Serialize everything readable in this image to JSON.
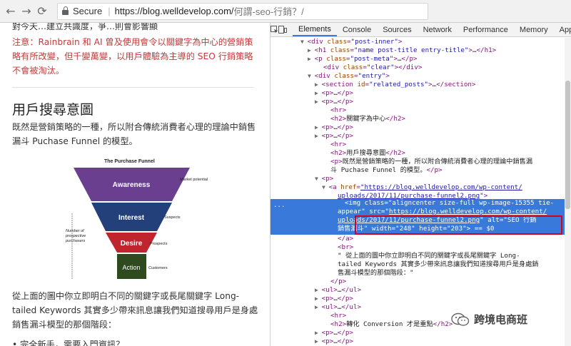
{
  "browser": {
    "back_glyph": "←",
    "forward_glyph": "→",
    "reload_glyph": "⟳",
    "secure_label": "Secure",
    "separator": "|",
    "url_host": "https://blog.welldevelop.com/",
    "url_path": "何謂-seo-行銷？/"
  },
  "article": {
    "top_clip": "對今天…建立共識度，爭…則會影響顯",
    "note": "注意：Rainbrain 和 AI 曾及使用會令以關鍵字為中心的營銷策略有所改變，但千變萬變，以用戶體驗為主導的 SEO 行銷策略不會被淘汰。",
    "heading": "用戶搜尋意圖",
    "para1": "既然是營銷策略的一種，所以附合傳統消費者心理的理論中銷售漏斗 Puchase Funnel 的模型。",
    "funnel": {
      "title": "The Purchase Funnel",
      "stages": [
        "Awareness",
        "Interest",
        "Desire",
        "Action"
      ],
      "right_labels": [
        "Market potential",
        "Suspects",
        "Prospects",
        "Customers"
      ],
      "left_label": "Number of prospective purchasers",
      "colors": [
        "#6b3f8f",
        "#23407a",
        "#c0242c",
        "#2f4a1f"
      ]
    },
    "para2": "從上面的圖中你立即明白不同的關鍵字或長尾關鍵字 Long-tailed Keywords 其實多少帶來訊息讓我們知道搜尋用戶是身處銷售漏斗模型的那個階段：",
    "bullet": "• 完全新手，需要入門資訊？"
  },
  "devtools": {
    "tabs": [
      "Elements",
      "Console",
      "Sources",
      "Network",
      "Performance",
      "Memory",
      "Applicat"
    ],
    "active_tab": "Elements",
    "accent": "#3879d9",
    "highlight_color": "#d3001c",
    "selected_dots": "...",
    "lines": [
      {
        "indent": 10,
        "tri": "▼",
        "parts": [
          [
            "tag",
            "<div "
          ],
          [
            "attr",
            "class"
          ],
          [
            "tag",
            "="
          ],
          [
            "val",
            "\"post-inner\""
          ],
          [
            "tag",
            ">"
          ]
        ]
      },
      {
        "indent": 12,
        "tri": "▶",
        "parts": [
          [
            "tag",
            "<h1 "
          ],
          [
            "attr",
            "class"
          ],
          [
            "tag",
            "="
          ],
          [
            "val",
            "\"name post-title entry-title\""
          ],
          [
            "tag",
            ">"
          ],
          [
            "txt",
            "…"
          ],
          [
            "tag",
            "</h1>"
          ]
        ]
      },
      {
        "indent": 12,
        "tri": "▶",
        "parts": [
          [
            "tag",
            "<p "
          ],
          [
            "attr",
            "class"
          ],
          [
            "tag",
            "="
          ],
          [
            "val",
            "\"post-meta\""
          ],
          [
            "tag",
            ">"
          ],
          [
            "txt",
            "…"
          ],
          [
            "tag",
            "</p>"
          ]
        ]
      },
      {
        "indent": 14,
        "tri": "",
        "parts": [
          [
            "tag",
            "<div "
          ],
          [
            "attr",
            "class"
          ],
          [
            "tag",
            "="
          ],
          [
            "val",
            "\"clear\""
          ],
          [
            "tag",
            "></div>"
          ]
        ]
      },
      {
        "indent": 12,
        "tri": "▼",
        "parts": [
          [
            "tag",
            "<div "
          ],
          [
            "attr",
            "class"
          ],
          [
            "tag",
            "="
          ],
          [
            "val",
            "\"entry\""
          ],
          [
            "tag",
            ">"
          ]
        ]
      },
      {
        "indent": 14,
        "tri": "▶",
        "parts": [
          [
            "tag",
            "<section "
          ],
          [
            "attr",
            "id"
          ],
          [
            "tag",
            "="
          ],
          [
            "val",
            "\"related_posts\""
          ],
          [
            "tag",
            ">"
          ],
          [
            "txt",
            "…"
          ],
          [
            "tag",
            "</section>"
          ]
        ]
      },
      {
        "indent": 14,
        "tri": "▶",
        "parts": [
          [
            "tag",
            "<p>"
          ],
          [
            "txt",
            "…"
          ],
          [
            "tag",
            "</p>"
          ]
        ]
      },
      {
        "indent": 14,
        "tri": "▶",
        "parts": [
          [
            "tag",
            "<p>"
          ],
          [
            "txt",
            "…"
          ],
          [
            "tag",
            "</p>"
          ]
        ]
      },
      {
        "indent": 16,
        "tri": "",
        "parts": [
          [
            "tag",
            "<hr>"
          ]
        ]
      },
      {
        "indent": 16,
        "tri": "",
        "parts": [
          [
            "tag",
            "<h2>"
          ],
          [
            "txt",
            "關鍵字為中心"
          ],
          [
            "tag",
            "</h2>"
          ]
        ]
      },
      {
        "indent": 14,
        "tri": "▶",
        "parts": [
          [
            "tag",
            "<p>"
          ],
          [
            "txt",
            "…"
          ],
          [
            "tag",
            "</p>"
          ]
        ]
      },
      {
        "indent": 14,
        "tri": "▶",
        "parts": [
          [
            "tag",
            "<p>"
          ],
          [
            "txt",
            "…"
          ],
          [
            "tag",
            "</p>"
          ]
        ]
      },
      {
        "indent": 16,
        "tri": "",
        "parts": [
          [
            "tag",
            "<hr>"
          ]
        ]
      },
      {
        "indent": 16,
        "tri": "",
        "parts": [
          [
            "tag",
            "<h2>"
          ],
          [
            "txt",
            "用戶搜尋意圖"
          ],
          [
            "tag",
            "</h2>"
          ]
        ]
      },
      {
        "indent": 16,
        "tri": "",
        "parts": [
          [
            "tag",
            "<p>"
          ],
          [
            "txt",
            "既然是營銷策略的一種，所以附合傳統消費者心理的理論中銷售漏"
          ]
        ]
      },
      {
        "indent": 16,
        "tri": "",
        "parts": [
          [
            "txt",
            "斗 Puchase Funnel 的模型。"
          ],
          [
            "tag",
            "</p>"
          ]
        ]
      },
      {
        "indent": 14,
        "tri": "▼",
        "parts": [
          [
            "tag",
            "<p>"
          ]
        ]
      },
      {
        "indent": 16,
        "tri": "▼",
        "parts": [
          [
            "tag",
            "<a "
          ],
          [
            "attr",
            "href"
          ],
          [
            "tag",
            "="
          ],
          [
            "link",
            "\"https://blog.welldevelop.com/wp-content/"
          ]
        ]
      },
      {
        "indent": 18,
        "tri": "",
        "parts": [
          [
            "link",
            "uploads/2017/11/purchase-funnel2.png"
          ],
          [
            "val",
            "\""
          ],
          [
            "tag",
            ">"
          ]
        ]
      },
      {
        "indent": 20,
        "tri": "",
        "parts": [
          [
            "tag",
            "<img "
          ],
          [
            "attr",
            "class"
          ],
          [
            "tag",
            "="
          ],
          [
            "val",
            "\"aligncenter size-full wp-image-15355 tie-"
          ]
        ]
      },
      {
        "indent": 18,
        "tri": "",
        "parts": [
          [
            "val",
            "appear\" "
          ],
          [
            "attr",
            "src"
          ],
          [
            "tag",
            "="
          ],
          [
            "val",
            "\""
          ],
          [
            "link",
            "https://blog.welldevelop.com/wp-content/"
          ]
        ]
      },
      {
        "indent": 18,
        "tri": "",
        "parts": [
          [
            "link",
            "uploads/2017/11/purchase-funnel2.png"
          ],
          [
            "val",
            "\" "
          ],
          [
            "attr",
            "alt"
          ],
          [
            "tag",
            "="
          ],
          [
            "val",
            "\"SEO 行銷"
          ]
        ]
      },
      {
        "indent": 18,
        "tri": "",
        "parts": [
          [
            "val",
            "銷售漏斗\" "
          ],
          [
            "attr",
            "width"
          ],
          [
            "tag",
            "="
          ],
          [
            "val",
            "\"248\" "
          ],
          [
            "attr",
            "height"
          ],
          [
            "tag",
            "="
          ],
          [
            "val",
            "\"203\""
          ],
          [
            "tag",
            "> "
          ],
          [
            "txt",
            "== $0"
          ]
        ]
      },
      {
        "indent": 18,
        "tri": "",
        "parts": [
          [
            "tag",
            "</a>"
          ]
        ]
      },
      {
        "indent": 18,
        "tri": "",
        "parts": [
          [
            "tag",
            "<br>"
          ]
        ]
      },
      {
        "indent": 18,
        "tri": "",
        "parts": [
          [
            "txt",
            "\" 從上面的圖中你立即明白不同的關鍵字或長尾關鍵字 Long-"
          ]
        ]
      },
      {
        "indent": 18,
        "tri": "",
        "parts": [
          [
            "txt",
            "tailed Keywords 其實多少帶來訊息讓我們知道搜尋用戶是身處銷"
          ]
        ]
      },
      {
        "indent": 18,
        "tri": "",
        "parts": [
          [
            "txt",
            "售漏斗模型的那個階段：\""
          ]
        ]
      },
      {
        "indent": 16,
        "tri": "",
        "parts": [
          [
            "tag",
            "</p>"
          ]
        ]
      },
      {
        "indent": 14,
        "tri": "▶",
        "parts": [
          [
            "tag",
            "<ul>"
          ],
          [
            "txt",
            "…"
          ],
          [
            "tag",
            "</ul>"
          ]
        ]
      },
      {
        "indent": 14,
        "tri": "▶",
        "parts": [
          [
            "tag",
            "<p>"
          ],
          [
            "txt",
            "…"
          ],
          [
            "tag",
            "</p>"
          ]
        ]
      },
      {
        "indent": 14,
        "tri": "▶",
        "parts": [
          [
            "tag",
            "<ul>"
          ],
          [
            "txt",
            "…"
          ],
          [
            "tag",
            "</ul>"
          ]
        ]
      },
      {
        "indent": 16,
        "tri": "",
        "parts": [
          [
            "tag",
            "<hr>"
          ]
        ]
      },
      {
        "indent": 16,
        "tri": "",
        "parts": [
          [
            "tag",
            "<h2>"
          ],
          [
            "txt",
            "轉化 Conversion 才是重點"
          ],
          [
            "tag",
            "</h2>"
          ]
        ]
      },
      {
        "indent": 14,
        "tri": "▶",
        "parts": [
          [
            "tag",
            "<p>"
          ],
          [
            "txt",
            "…"
          ],
          [
            "tag",
            "</p>"
          ]
        ]
      },
      {
        "indent": 14,
        "tri": "▶",
        "parts": [
          [
            "tag",
            "<p>"
          ],
          [
            "txt",
            "…"
          ],
          [
            "tag",
            "</p>"
          ]
        ]
      }
    ]
  },
  "watermark": {
    "text": "跨境电商班"
  }
}
